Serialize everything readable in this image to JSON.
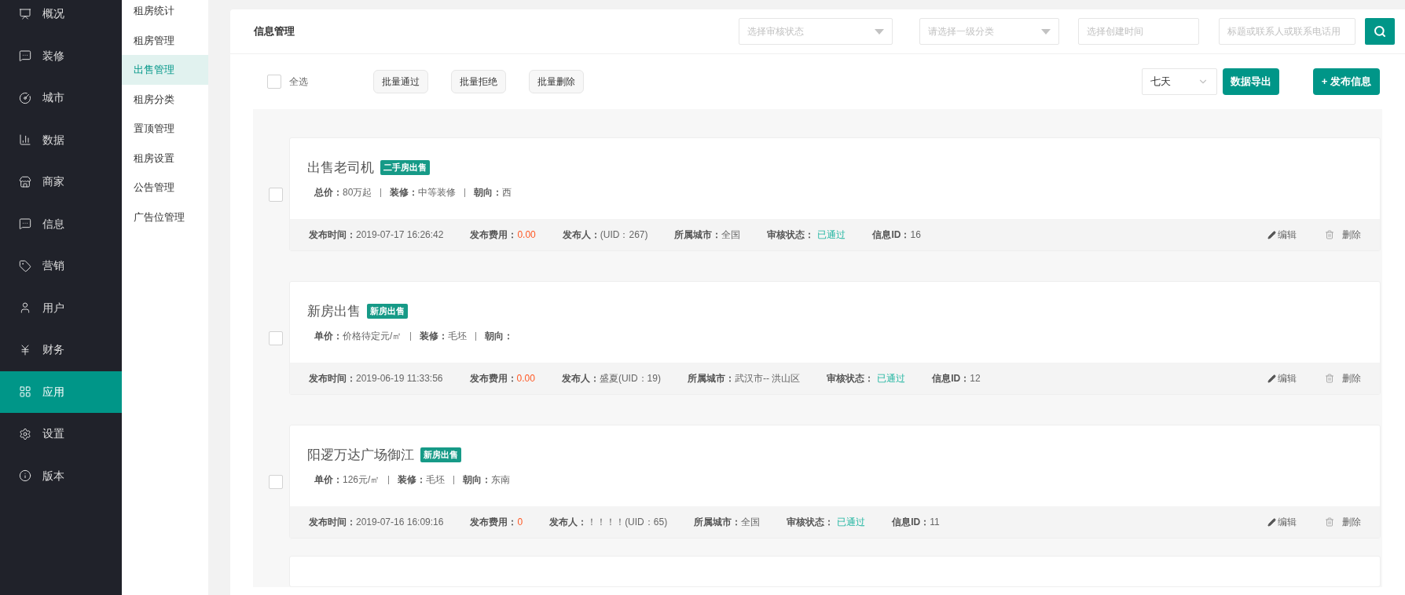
{
  "sidebar": {
    "items": [
      {
        "label": "概况",
        "kind": "overview",
        "selected": false
      },
      {
        "label": "装修",
        "kind": "chat",
        "selected": false
      },
      {
        "label": "城市",
        "kind": "gauge",
        "selected": false
      },
      {
        "label": "数据",
        "kind": "bars",
        "selected": false
      },
      {
        "label": "商家",
        "kind": "store",
        "selected": false
      },
      {
        "label": "信息",
        "kind": "chat",
        "selected": false
      },
      {
        "label": "营销",
        "kind": "tag",
        "selected": false
      },
      {
        "label": "用户",
        "kind": "user",
        "selected": false
      },
      {
        "label": "财务",
        "kind": "yen",
        "selected": false
      },
      {
        "label": "应用",
        "kind": "apps",
        "selected": true
      },
      {
        "label": "设置",
        "kind": "settings",
        "selected": false
      },
      {
        "label": "版本",
        "kind": "info",
        "selected": false
      }
    ]
  },
  "submenu": {
    "items": [
      {
        "label": "租房统计",
        "selected": false
      },
      {
        "label": "租房管理",
        "selected": false
      },
      {
        "label": "出售管理",
        "selected": true
      },
      {
        "label": "租房分类",
        "selected": false
      },
      {
        "label": "置顶管理",
        "selected": false
      },
      {
        "label": "租房设置",
        "selected": false
      },
      {
        "label": "公告管理",
        "selected": false
      },
      {
        "label": "广告位管理",
        "selected": false
      }
    ]
  },
  "header": {
    "title": "信息管理",
    "filters": [
      {
        "kind": "select",
        "placeholder": "选择审核状态"
      },
      {
        "kind": "select",
        "placeholder": "请选择一级分类"
      },
      {
        "kind": "input",
        "placeholder": "选择创建时间"
      },
      {
        "kind": "input",
        "placeholder": "标题或联系人或联系电话用"
      }
    ]
  },
  "toolbar": {
    "select_all": {
      "label": "全选",
      "checked": false
    },
    "batch_buttons": [
      "批量通过",
      "批量拒绝",
      "批量删除"
    ],
    "period": "七天",
    "export": "数据导出",
    "publish": "+ 发布信息"
  },
  "listings": [
    {
      "checked": false,
      "title": "出售老司机",
      "tag": "二手房出售",
      "specs": [
        {
          "label": "总价：",
          "value": "80万起"
        },
        {
          "label": "装修：",
          "value": "中等装修"
        },
        {
          "label": "朝向：",
          "value": "西"
        }
      ],
      "meta": [
        {
          "kind": "plain",
          "label": "发布时间：",
          "value": "2019-07-17 16:26:42"
        },
        {
          "kind": "fee",
          "label": "发布费用：",
          "value": "0.00"
        },
        {
          "kind": "plain",
          "label": "发布人：",
          "value": "(UID：267)"
        },
        {
          "kind": "plain",
          "label": "所属城市：",
          "value": "全国"
        },
        {
          "kind": "status",
          "label": "审核状态：",
          "value": "已通过"
        },
        {
          "kind": "plain",
          "label": "信息ID：",
          "value": "16"
        }
      ],
      "edit": "编辑",
      "delete": "删除"
    },
    {
      "checked": false,
      "title": "新房出售",
      "tag": "新房出售",
      "specs": [
        {
          "label": "单价：",
          "value": "价格待定元/㎡"
        },
        {
          "label": "装修：",
          "value": "毛坯"
        },
        {
          "label": "朝向："
        }
      ],
      "meta": [
        {
          "kind": "plain",
          "label": "发布时间：",
          "value": "2019-06-19 11:33:56"
        },
        {
          "kind": "fee",
          "label": "发布费用：",
          "value": "0.00"
        },
        {
          "kind": "plain",
          "label": "发布人：",
          "value": "盛夏(UID：19)"
        },
        {
          "kind": "plain",
          "label": "所属城市：",
          "value": "武汉市-- 洪山区"
        },
        {
          "kind": "status",
          "label": "审核状态：",
          "value": "已通过"
        },
        {
          "kind": "plain",
          "label": "信息ID：",
          "value": "12"
        }
      ],
      "edit": "编辑",
      "delete": "删除"
    },
    {
      "checked": false,
      "title": "阳逻万达广场御江",
      "tag": "新房出售",
      "specs": [
        {
          "label": "单价：",
          "value": "126元/㎡"
        },
        {
          "label": "装修：",
          "value": "毛坯"
        },
        {
          "label": "朝向：",
          "value": "东南"
        }
      ],
      "meta": [
        {
          "kind": "plain",
          "label": "发布时间：",
          "value": "2019-07-16 16:09:16"
        },
        {
          "kind": "fee",
          "label": "发布费用：",
          "value": "0"
        },
        {
          "kind": "plain",
          "label": "发布人：",
          "value": "！！！！(UID：65)"
        },
        {
          "kind": "plain",
          "label": "所属城市：",
          "value": "全国"
        },
        {
          "kind": "status",
          "label": "审核状态：",
          "value": "已通过"
        },
        {
          "kind": "plain",
          "label": "信息ID：",
          "value": "11"
        }
      ],
      "edit": "编辑",
      "delete": "删除"
    }
  ]
}
